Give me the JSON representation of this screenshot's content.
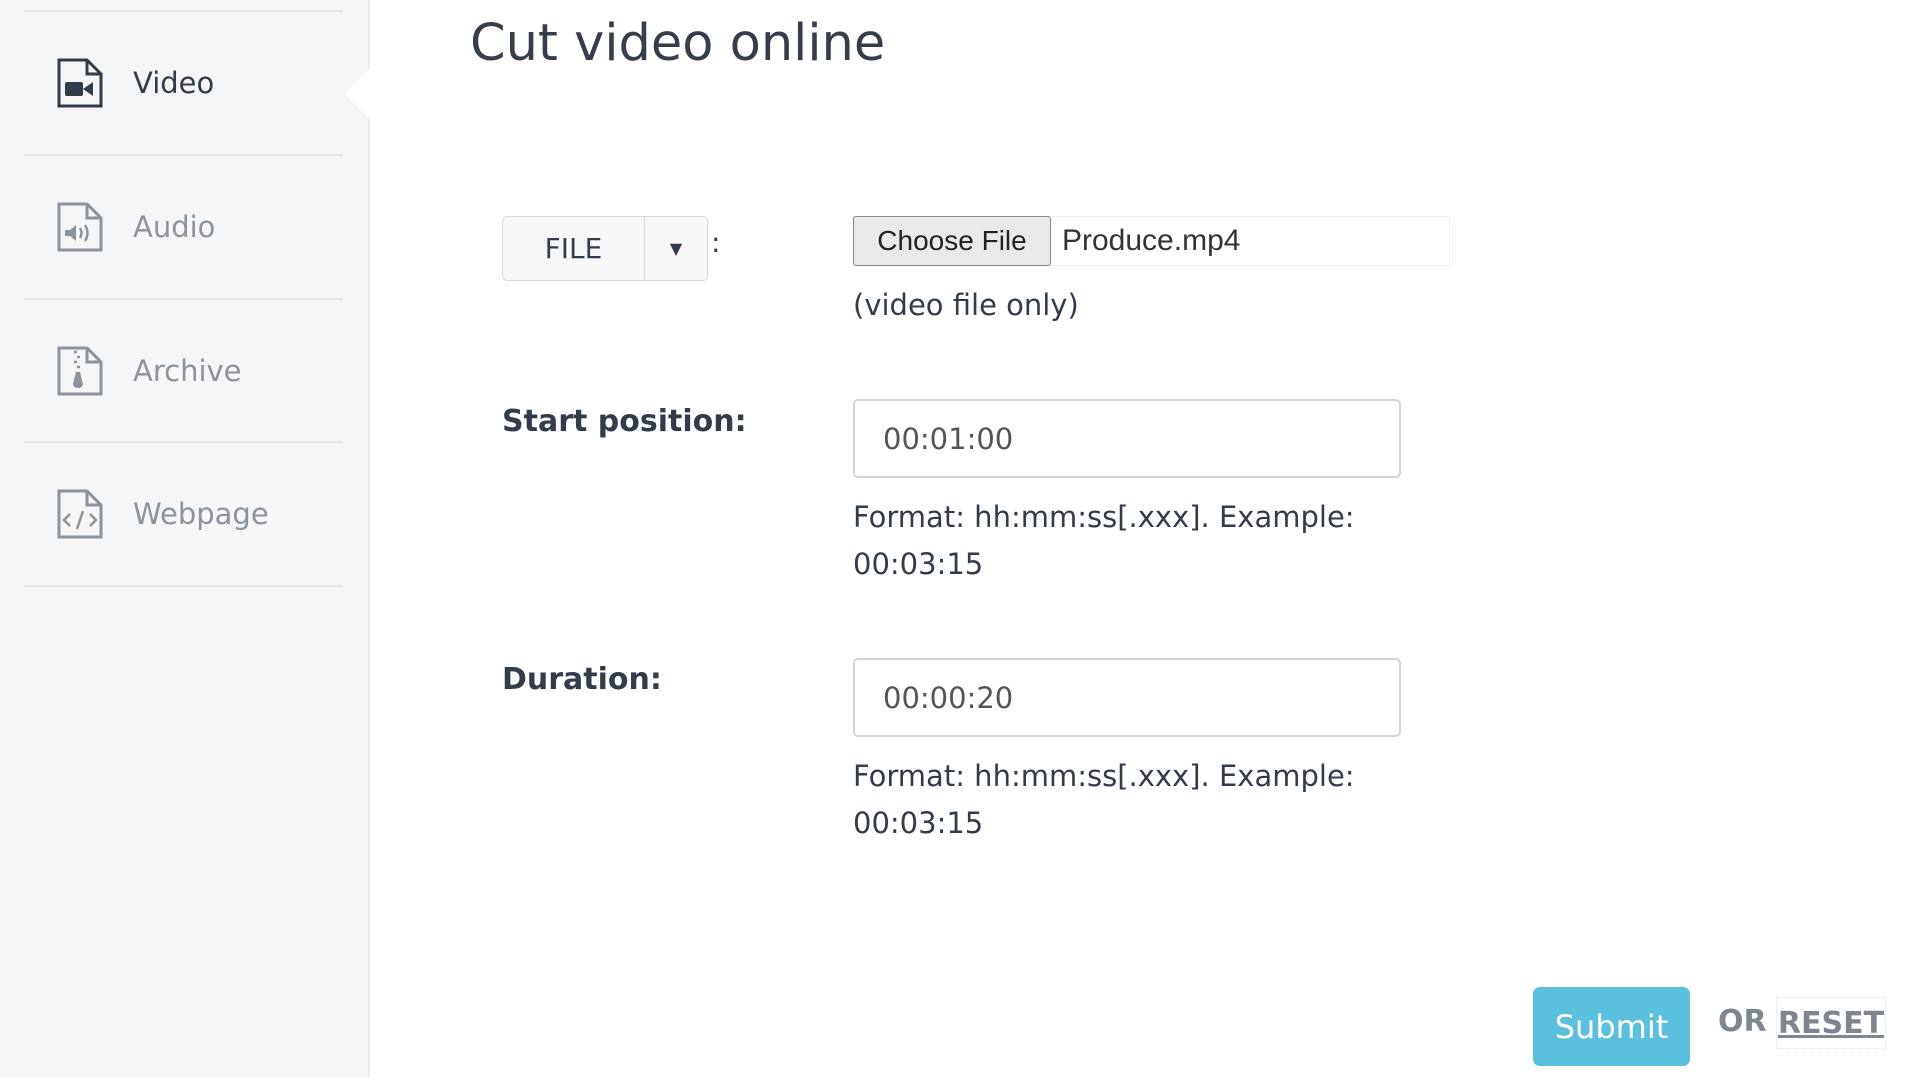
{
  "sidebar": {
    "items": [
      {
        "label": "Video",
        "icon": "video-file-icon",
        "active": true
      },
      {
        "label": "Audio",
        "icon": "audio-file-icon"
      },
      {
        "label": "Archive",
        "icon": "archive-file-icon"
      },
      {
        "label": "Webpage",
        "icon": "webpage-file-icon"
      }
    ]
  },
  "main": {
    "title": "Cut video online",
    "source": {
      "selected": "FILE",
      "colon": ":"
    },
    "file": {
      "button": "Choose File",
      "filename": "Produce.mp4",
      "hint": "(video file only)"
    },
    "start": {
      "label": "Start position:",
      "value": "00:01:00",
      "hint1": "Format: hh:mm:ss[.xxx]. Example:",
      "hint2": "00:03:15"
    },
    "duration": {
      "label": "Duration:",
      "value": "00:00:20",
      "hint1": "Format: hh:mm:ss[.xxx]. Example:",
      "hint2": "00:03:15"
    },
    "submit": "Submit",
    "or": "OR",
    "reset": "RESET"
  },
  "colors": {
    "accent": "#5bc0de",
    "sidebar_bg": "#f6f6f6"
  }
}
